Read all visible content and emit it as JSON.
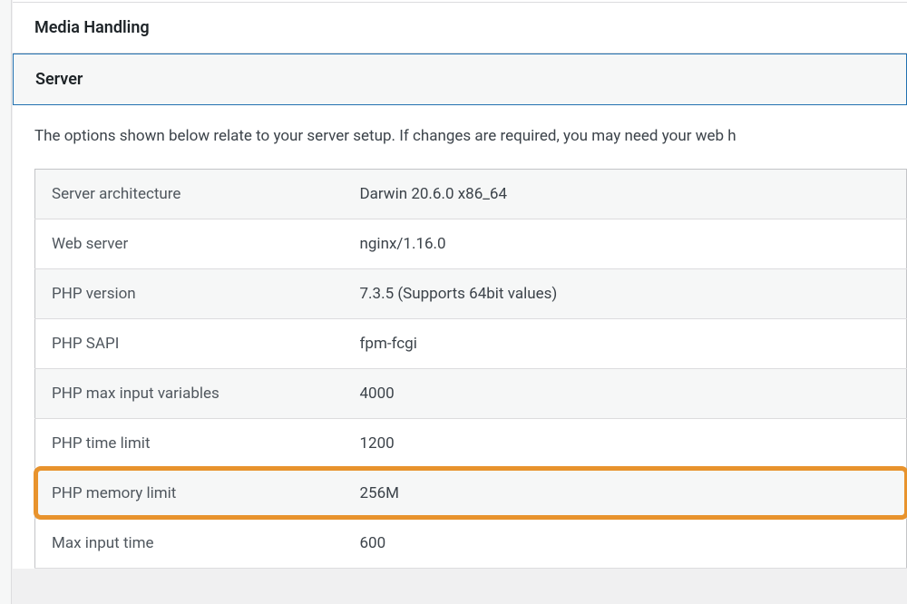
{
  "sections": {
    "media_handling": {
      "title": "Media Handling"
    },
    "server": {
      "title": "Server",
      "description": "The options shown below relate to your server setup. If changes are required, you may need your web h",
      "rows": [
        {
          "label": "Server architecture",
          "value": "Darwin 20.6.0 x86_64",
          "highlight": false
        },
        {
          "label": "Web server",
          "value": "nginx/1.16.0",
          "highlight": false
        },
        {
          "label": "PHP version",
          "value": "7.3.5 (Supports 64bit values)",
          "highlight": false
        },
        {
          "label": "PHP SAPI",
          "value": "fpm-fcgi",
          "highlight": false
        },
        {
          "label": "PHP max input variables",
          "value": "4000",
          "highlight": false
        },
        {
          "label": "PHP time limit",
          "value": "1200",
          "highlight": false
        },
        {
          "label": "PHP memory limit",
          "value": "256M",
          "highlight": true
        },
        {
          "label": "Max input time",
          "value": "600",
          "highlight": false
        }
      ]
    }
  }
}
